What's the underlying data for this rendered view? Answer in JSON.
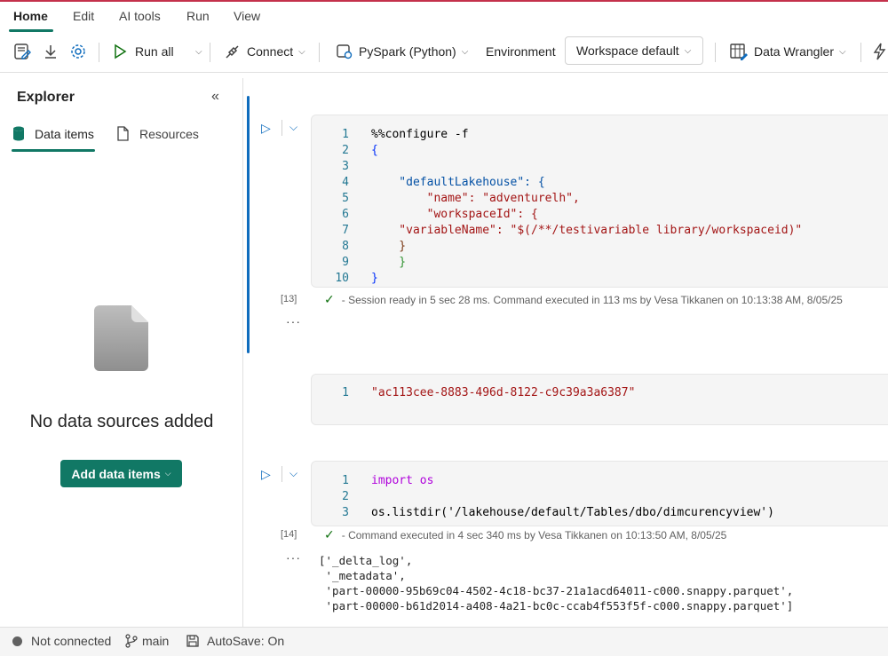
{
  "menu": {
    "tabs": [
      "Home",
      "Edit",
      "AI tools",
      "Run",
      "View"
    ]
  },
  "toolbar": {
    "run_all": "Run all",
    "connect": "Connect",
    "language": "PySpark (Python)",
    "environment": "Environment",
    "workspace": "Workspace default",
    "data_wrangler": "Data Wrangler"
  },
  "explorer": {
    "title": "Explorer",
    "tabs": [
      "Data items",
      "Resources"
    ],
    "empty_text": "No data sources added",
    "add_button": "Add data items"
  },
  "cells": [
    {
      "exec_count": "[13]",
      "status": "- Session ready in 5 sec 28 ms. Command executed in 113 ms by Vesa Tikkanen on 10:13:38 AM, 8/05/25",
      "line_numbers": [
        "1",
        "2",
        "3",
        "4",
        "5",
        "6",
        "7",
        "8",
        "9",
        "10"
      ],
      "lines": [
        "%%configure -f",
        "{",
        "",
        "    \"defaultLakehouse\": {",
        "        \"name\": \"adventurelh\",",
        "        \"workspaceId\": {",
        "    \"variableName\": \"$(/**/testivariable library/workspaceid)\"",
        "    }",
        "    }",
        "}"
      ]
    },
    {
      "line_numbers": [
        "1"
      ],
      "lines": [
        "\"ac113cee-8883-496d-8122-c9c39a3a6387\""
      ]
    },
    {
      "exec_count": "[14]",
      "status": "- Command executed in 4 sec 340 ms by Vesa Tikkanen on 10:13:50 AM, 8/05/25",
      "line_numbers": [
        "1",
        "2",
        "3"
      ],
      "lines": [
        "import os",
        "",
        "os.listdir('/lakehouse/default/Tables/dbo/dimcurencyview')"
      ],
      "output": [
        "['_delta_log',",
        " '_metadata',",
        " 'part-00000-95b69c04-4502-4c18-bc37-21a1acd64011-c000.snappy.parquet',",
        " 'part-00000-b61d2014-a408-4a21-bc0c-ccab4f553f5f-c000.snappy.parquet']"
      ]
    }
  ],
  "statusbar": {
    "connection": "Not connected",
    "branch": "main",
    "autosave": "AutoSave: On"
  }
}
